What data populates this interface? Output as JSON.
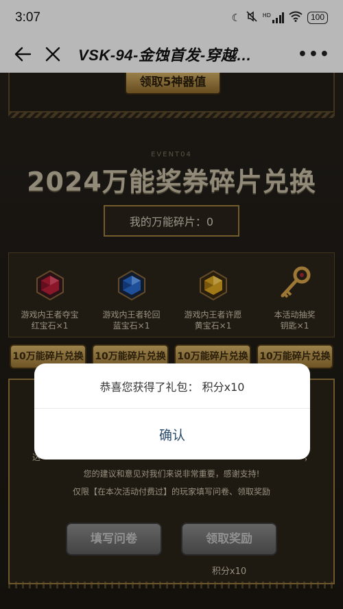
{
  "status_bar": {
    "time": "3:07",
    "signal_label": "HD",
    "battery": "100"
  },
  "nav": {
    "title": "VSK-94-金蚀首发-穿越…"
  },
  "page": {
    "top_button": "领取5神器值",
    "event_label": "EVENT04",
    "section_title": "2024万能奖券碎片兑换",
    "balance": "我的万能碎片：0",
    "rewards": [
      {
        "name_line1": "游戏内王者夺宝",
        "name_line2": "红宝石×1",
        "icon": "red-gem-icon",
        "color": "#c0203a"
      },
      {
        "name_line1": "游戏内王者轮回",
        "name_line2": "蓝宝石×1",
        "icon": "blue-gem-icon",
        "color": "#2a6fd6"
      },
      {
        "name_line1": "游戏内王者许愿",
        "name_line2": "黄宝石×1",
        "icon": "yellow-gem-icon",
        "color": "#e0a820"
      },
      {
        "name_line1": "本活动抽奖",
        "name_line2": "钥匙×1",
        "icon": "key-icon",
        "color": "#d9a64a"
      }
    ],
    "exchange_buttons": [
      "10万能碎片兑换",
      "10万能碎片兑换",
      "10万能碎片兑换",
      "10万能碎片兑换"
    ],
    "survey_left_char": "达",
    "survey_right_char": "，",
    "survey_line1": "您的建议和意见对我们来说非常重要，感谢支持!",
    "survey_line2": "仅限【在本次活动付费过】的玩家填写问卷、领取奖励",
    "fill_survey_button": "填写问卷",
    "claim_reward_button": "领取奖励",
    "points_label": "积分x10"
  },
  "dialog": {
    "message": "恭喜您获得了礼包：  积分x10",
    "confirm": "确认"
  }
}
